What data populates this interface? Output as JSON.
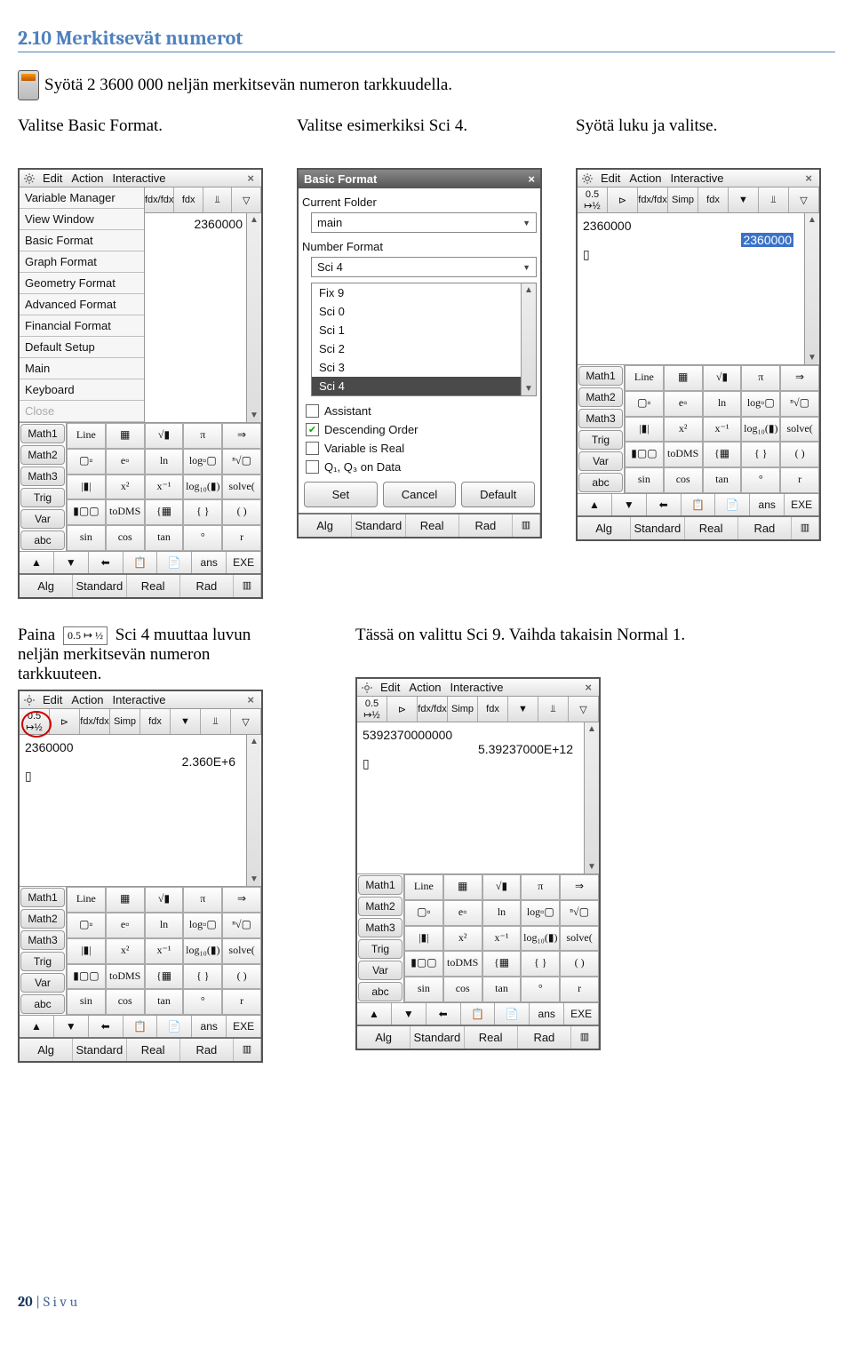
{
  "heading": "2.10 Merkitsevät numerot",
  "intro": "Syötä 2 3600 000 neljän merkitsevän numeron tarkkuudella.",
  "row1": {
    "c1": "Valitse Basic Format.",
    "c2": "Valitse esimerkiksi Sci 4.",
    "c3": "Syötä luku ja valitse."
  },
  "titlebar": {
    "edit": "Edit",
    "action": "Action",
    "interactive": "Interactive"
  },
  "menu": [
    "Variable Manager",
    "View Window",
    "Basic Format",
    "Graph Format",
    "Geometry Format",
    "Advanced Format",
    "Financial Format",
    "Default Setup",
    "Main",
    "Keyboard",
    "Close"
  ],
  "calc1": {
    "answer": "2360000",
    "toolbar": [
      "fdx/fdx",
      "Simp",
      "fdx",
      "▼",
      "⫫",
      "▽"
    ]
  },
  "dlg": {
    "title": "Basic Format",
    "cf_label": "Current Folder",
    "cf_value": "main",
    "nf_label": "Number Format",
    "nf_value": "Sci 4",
    "list": [
      "Fix 9",
      "Sci 0",
      "Sci 1",
      "Sci 2",
      "Sci 3",
      "Sci 4"
    ],
    "assist": "Assistant",
    "desc": "Descending Order",
    "vir": "Variable is Real",
    "q": "Q₁, Q₃ on Data",
    "btns": [
      "Set",
      "Cancel",
      "Default"
    ]
  },
  "calc3": {
    "in": "2360000",
    "out": "2360000"
  },
  "kptabs": [
    "Math1",
    "Math2",
    "Math3",
    "Trig",
    "Var",
    "abc"
  ],
  "keys1": [
    [
      "Line",
      "▦",
      "√▮",
      "π",
      "⇒"
    ],
    [
      "▢▫",
      "e▫",
      "ln",
      "log▫▢",
      "ⁿ√▢"
    ],
    [
      "|▮|",
      "x²",
      "x⁻¹",
      "log₁₀(▮)",
      "solve("
    ],
    [
      "▮▢▢",
      "toDMS",
      "{▦",
      "{ }",
      "( )"
    ],
    [
      "sin",
      "cos",
      "tan",
      "°",
      "r"
    ]
  ],
  "botkeys": [
    "▲",
    "▼",
    "⬅",
    "📋",
    "📄",
    "ans",
    "EXE"
  ],
  "status": [
    "Alg",
    "Standard",
    "Real",
    "Rad"
  ],
  "row2": {
    "c1a": "Paina ",
    "c1b": " Sci 4 muuttaa luvun neljän merkitsevän numeron tarkkuuteen.",
    "c2": "Tässä on valittu Sci 9. Vaihda takaisin Normal 1."
  },
  "calc4": {
    "in": "2360000",
    "out": "2.360E+6"
  },
  "calc5": {
    "in": "5392370000000",
    "out": "5.39237000E+12"
  },
  "footer": {
    "page": "20",
    "rest": " | S i v u"
  },
  "icon05": "0.5 ½"
}
